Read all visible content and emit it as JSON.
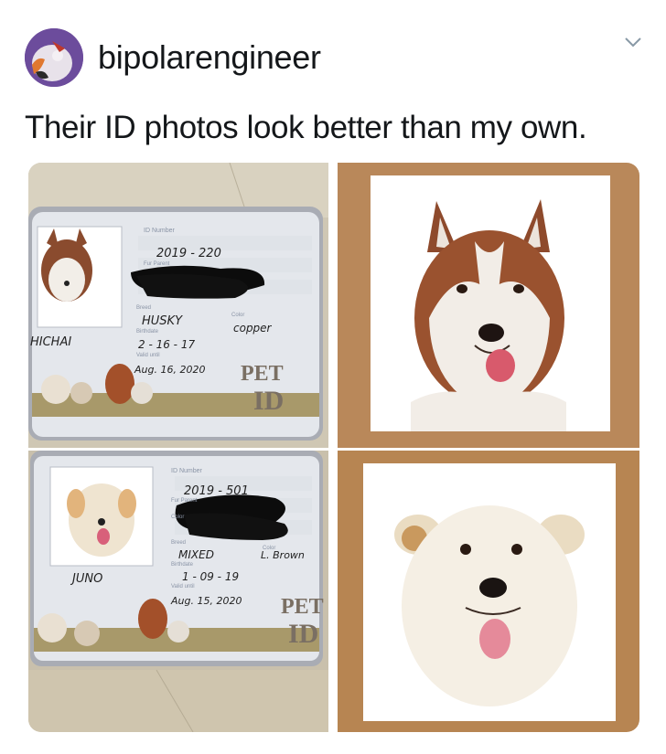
{
  "tweet": {
    "username": "bipolarengineer",
    "text": "Their ID photos look better than my own."
  },
  "icons": {
    "avatar": "avatar-image",
    "menu": "chevron-down-icon"
  },
  "card_top": {
    "id_label": "ID Number",
    "id_number": "2019 - 220",
    "fur_parent_label": "Fur Parent",
    "breed_label": "Breed",
    "breed": "HUSKY",
    "color_label": "Color",
    "color": "copper",
    "birthdate_label": "Birthdate",
    "birthdate": "2 - 16 - 17",
    "valid_label": "Valid until",
    "valid_until": "Aug. 16, 2020",
    "name": "HICHAI",
    "logo_line1": "PET",
    "logo_line2": "ID"
  },
  "card_bottom": {
    "id_label": "ID Number",
    "id_number": "2019 - 501",
    "fur_parent_label": "Fur Parent",
    "color_label": "Color",
    "breed_label": "Breed",
    "breed": "MIXED",
    "color": "L. Brown",
    "birthdate_label": "Birthdate",
    "birthdate": "1 - 09 - 19",
    "valid_label": "Valid until",
    "valid_until": "Aug. 15, 2020",
    "name": "JUNO",
    "logo_line1": "PET",
    "logo_line2": "ID"
  }
}
